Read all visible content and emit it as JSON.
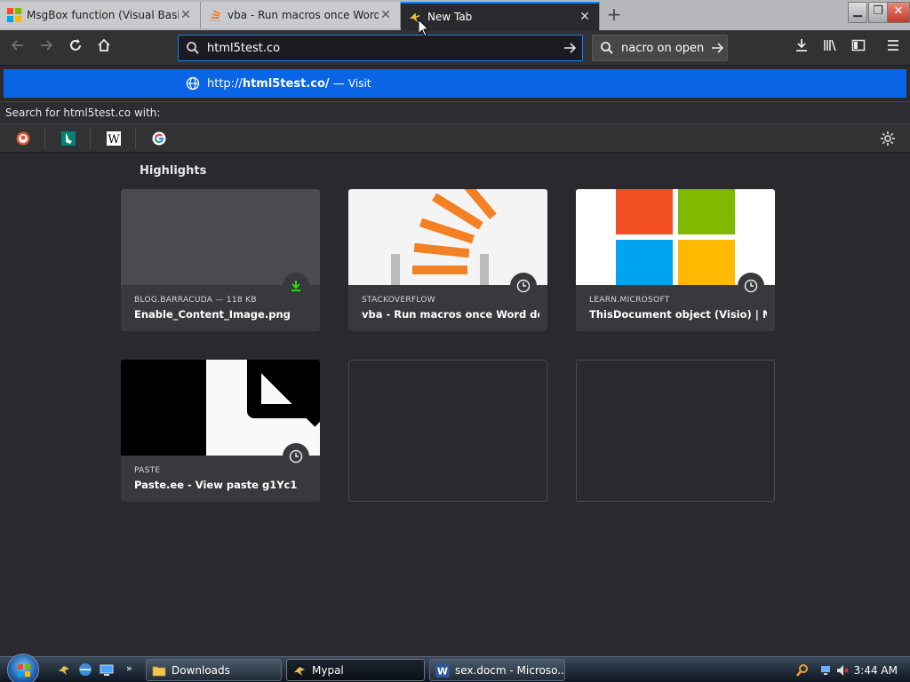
{
  "tabs": [
    {
      "title": "MsgBox function (Visual Basic",
      "icon": "microsoft-icon",
      "active": false
    },
    {
      "title": "vba - Run macros once Word",
      "icon": "stackoverflow-icon",
      "active": false
    },
    {
      "title": "New Tab",
      "icon": "mypal-icon",
      "active": true
    }
  ],
  "navbar": {
    "url_value": "html5test.co",
    "search_value": "nacro on open"
  },
  "suggestion": {
    "prefix": "http://",
    "domain": "html5test.co/",
    "separator": " — ",
    "action": "Visit"
  },
  "search_with_label": "Search for html5test.co with:",
  "engines": [
    "duckduckgo-icon",
    "bing-icon",
    "wikipedia-icon",
    "google-icon"
  ],
  "highlights": {
    "title": "Highlights",
    "cards": [
      {
        "host": "BLOG.BARRACUDA — 118 KB",
        "title": "Enable_Content_Image.png",
        "badge": "download-icon"
      },
      {
        "host": "STACKOVERFLOW",
        "title": "vba - Run macros once Word do...",
        "badge": "clock-icon"
      },
      {
        "host": "LEARN.MICROSOFT",
        "title": "ThisDocument object (Visio) | Mi...",
        "badge": "clock-icon"
      },
      {
        "host": "PASTE",
        "title": "Paste.ee - View paste g1Yc1",
        "badge": "clock-icon"
      }
    ]
  },
  "taskbar": {
    "tasks": [
      "Downloads",
      "Mypal",
      "sex.docm - Microso..."
    ],
    "time": "3:44 AM"
  },
  "colors": {
    "accent": "#0a84ff",
    "suggest_bg": "#0a65e6",
    "page_bg": "#2a2a2e"
  }
}
